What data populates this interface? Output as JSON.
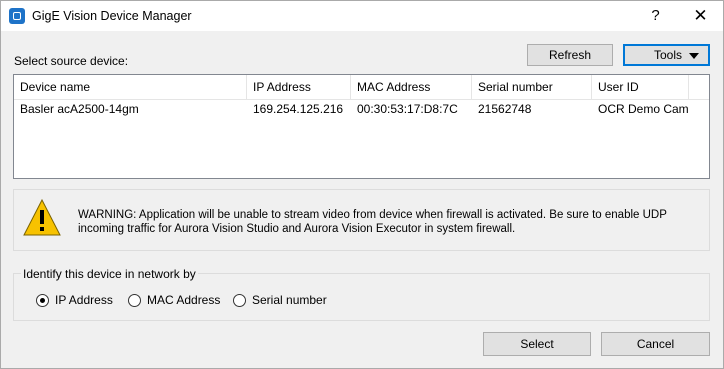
{
  "window": {
    "title": "GigE Vision Device Manager",
    "help_label": "?",
    "close_label": "✕"
  },
  "source": {
    "label": "Select source device:",
    "refresh_label": "Refresh",
    "tools_label": "Tools"
  },
  "devices": {
    "columns": [
      "Device name",
      "IP Address",
      "MAC Address",
      "Serial number",
      "User ID"
    ],
    "rows": [
      [
        "Basler acA2500-14gm",
        "169.254.125.216",
        "00:30:53:17:D8:7C",
        "21562748",
        "OCR Demo Cam..."
      ]
    ]
  },
  "warning": {
    "icon": "warning-triangle-icon",
    "text": "WARNING: Application will be unable to stream video from device when firewall is activated. Be sure to enable UDP incoming traffic for Aurora Vision Studio and Aurora Vision Executor in system firewall."
  },
  "identify": {
    "title": "Identify this device in network by",
    "options": [
      {
        "label": "IP Address",
        "checked": true
      },
      {
        "label": "MAC Address",
        "checked": false
      },
      {
        "label": "Serial number",
        "checked": false
      }
    ]
  },
  "actions": {
    "select_label": "Select",
    "cancel_label": "Cancel"
  },
  "colors": {
    "accent": "#0078d7",
    "warning_yellow": "#f7c200"
  }
}
